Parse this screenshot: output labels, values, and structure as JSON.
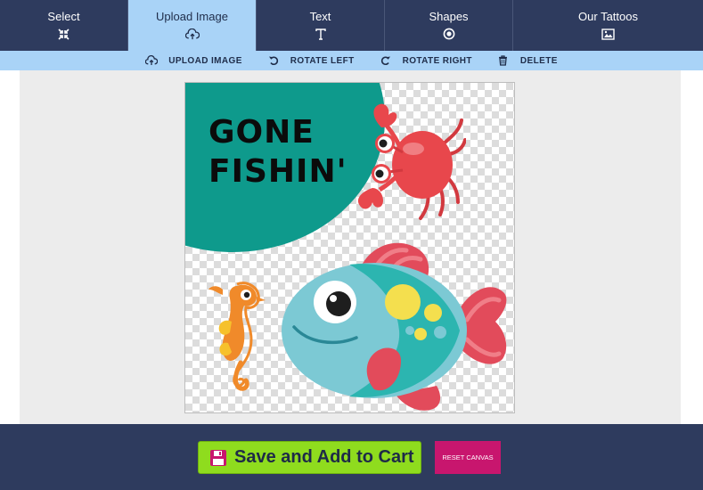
{
  "tabs": [
    {
      "label": "Select",
      "icon": "compress-arrows-icon"
    },
    {
      "label": "Upload Image",
      "icon": "cloud-upload-icon",
      "active": true
    },
    {
      "label": "Text",
      "icon": "text-icon"
    },
    {
      "label": "Shapes",
      "icon": "circle-dot-icon"
    },
    {
      "label": "Our Tattoos",
      "icon": "image-icon"
    }
  ],
  "toolbar": {
    "upload_image": "UPLOAD IMAGE",
    "rotate_left": "ROTATE LEFT",
    "rotate_right": "ROTATE RIGHT",
    "delete": "DELETE"
  },
  "canvas": {
    "caption_line1": "GONE",
    "caption_line2": "FISHIN'",
    "stickers": [
      "crab",
      "seahorse",
      "fish"
    ]
  },
  "footer": {
    "save_label": "Save and Add to Cart",
    "reset_label": "RESET CANVAS"
  },
  "colors": {
    "navy": "#2e3b5e",
    "light_blue": "#a9d3f7",
    "teal": "#0e9a8c",
    "save_green": "#8fdc1e",
    "reset_magenta": "#c8166e"
  }
}
